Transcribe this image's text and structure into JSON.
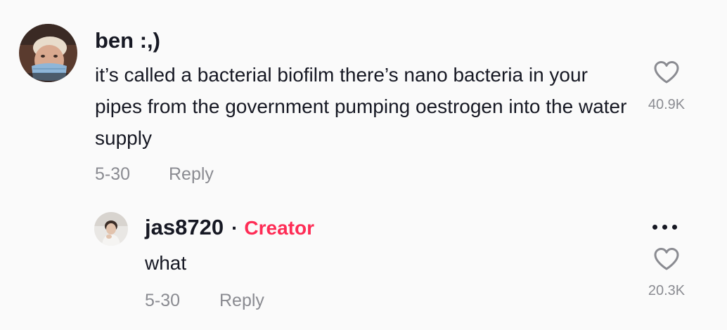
{
  "comment": {
    "username": "ben :,)",
    "text": "it’s called a bacterial biofilm there’s nano bacteria in your pipes from the government pumping oestrogen into the water supply",
    "date": "5-30",
    "reply_label": "Reply",
    "likes": "40.9K",
    "avatar_icon": "user-avatar-photo",
    "like_icon": "heart-outline-icon"
  },
  "reply": {
    "username": "jas8720",
    "badge": "Creator",
    "badge_color": "#fe2c55",
    "text": "what",
    "date": "5-30",
    "reply_label": "Reply",
    "likes": "20.3K",
    "avatar_icon": "user-avatar-photo",
    "like_icon": "heart-outline-icon",
    "more_icon": "more-options-icon"
  },
  "colors": {
    "text_primary": "#161823",
    "text_secondary": "#8a8b91",
    "background": "#fafafa"
  }
}
